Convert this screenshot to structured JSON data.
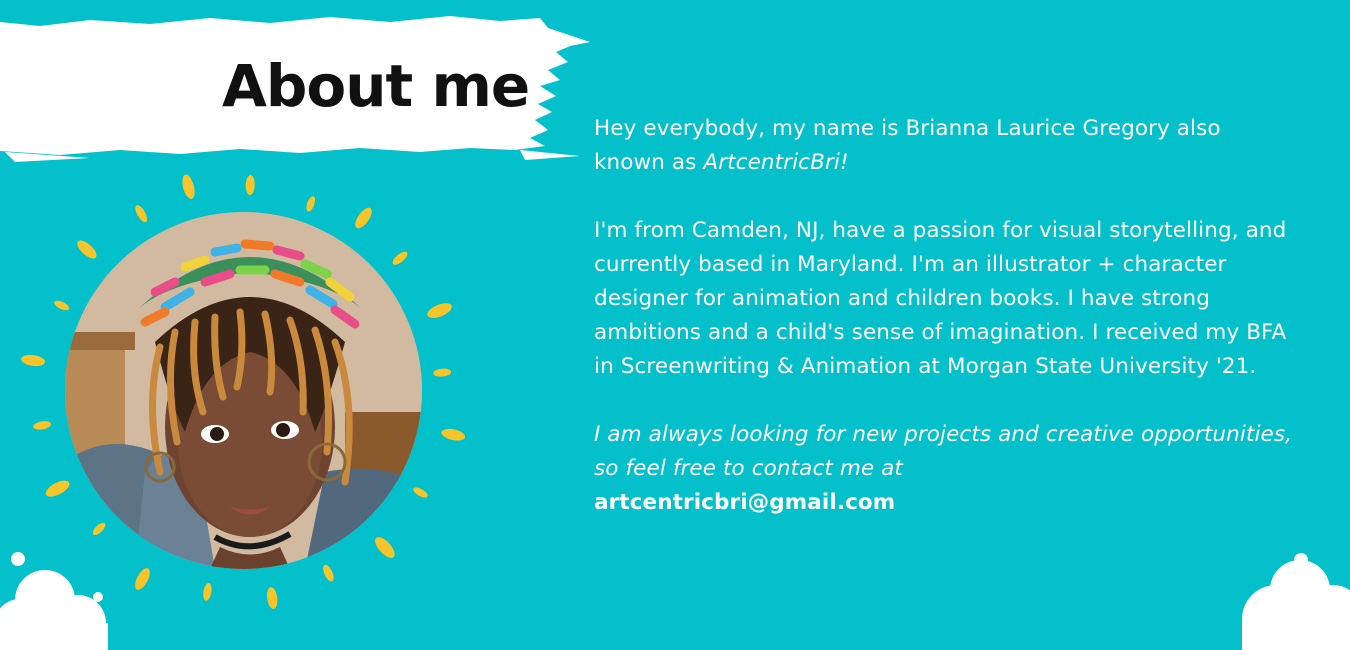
{
  "heading": {
    "title": "About me"
  },
  "intro": {
    "text": "Hey everybody, my name is Brianna Laurice Gregory also known as ",
    "alias": "ArtcentricBri!"
  },
  "bio": {
    "text": "I'm from Camden, NJ, have a passion for visual storytelling, and currently based in Maryland. I'm an illustrator + character designer for animation and children books. I have strong ambitions and a child's sense of imagination. I received my BFA in Screenwriting & Animation at Morgan State University '21."
  },
  "contact": {
    "text": "I am always looking for new projects and creative opportunities, so feel free to contact me at",
    "email": "artcentricbri@gmail.com"
  },
  "colors": {
    "background": "#04c0cb",
    "accent_yellow": "#f7c52a",
    "banner": "#ffffff",
    "text": "#ffffff"
  },
  "icons": [
    "brush-stroke-banner",
    "sunburst-rays",
    "portrait-photo",
    "cloud-icon"
  ]
}
